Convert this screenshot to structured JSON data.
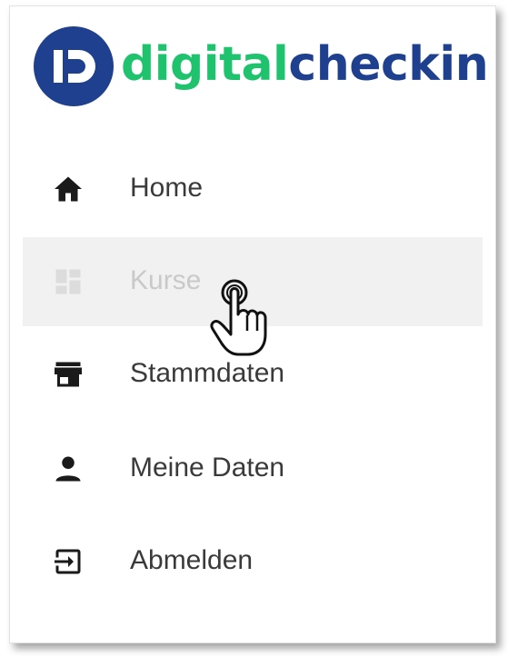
{
  "logo": {
    "text_part1": "digital",
    "text_part2": "checkin",
    "mark_letter": "D",
    "colors": {
      "mark": "#1f3f8f",
      "green": "#1fc36e",
      "blue": "#1f3f8f"
    }
  },
  "nav": {
    "items": [
      {
        "label": "Home",
        "icon": "home-icon",
        "active": false
      },
      {
        "label": "Kurse",
        "icon": "dashboard-icon",
        "active": true
      },
      {
        "label": "Stammdaten",
        "icon": "store-icon",
        "active": false
      },
      {
        "label": "Meine Daten",
        "icon": "person-icon",
        "active": false
      },
      {
        "label": "Abmelden",
        "icon": "logout-icon",
        "active": false
      }
    ]
  },
  "cursor": {
    "icon": "hand-pointer-icon"
  }
}
